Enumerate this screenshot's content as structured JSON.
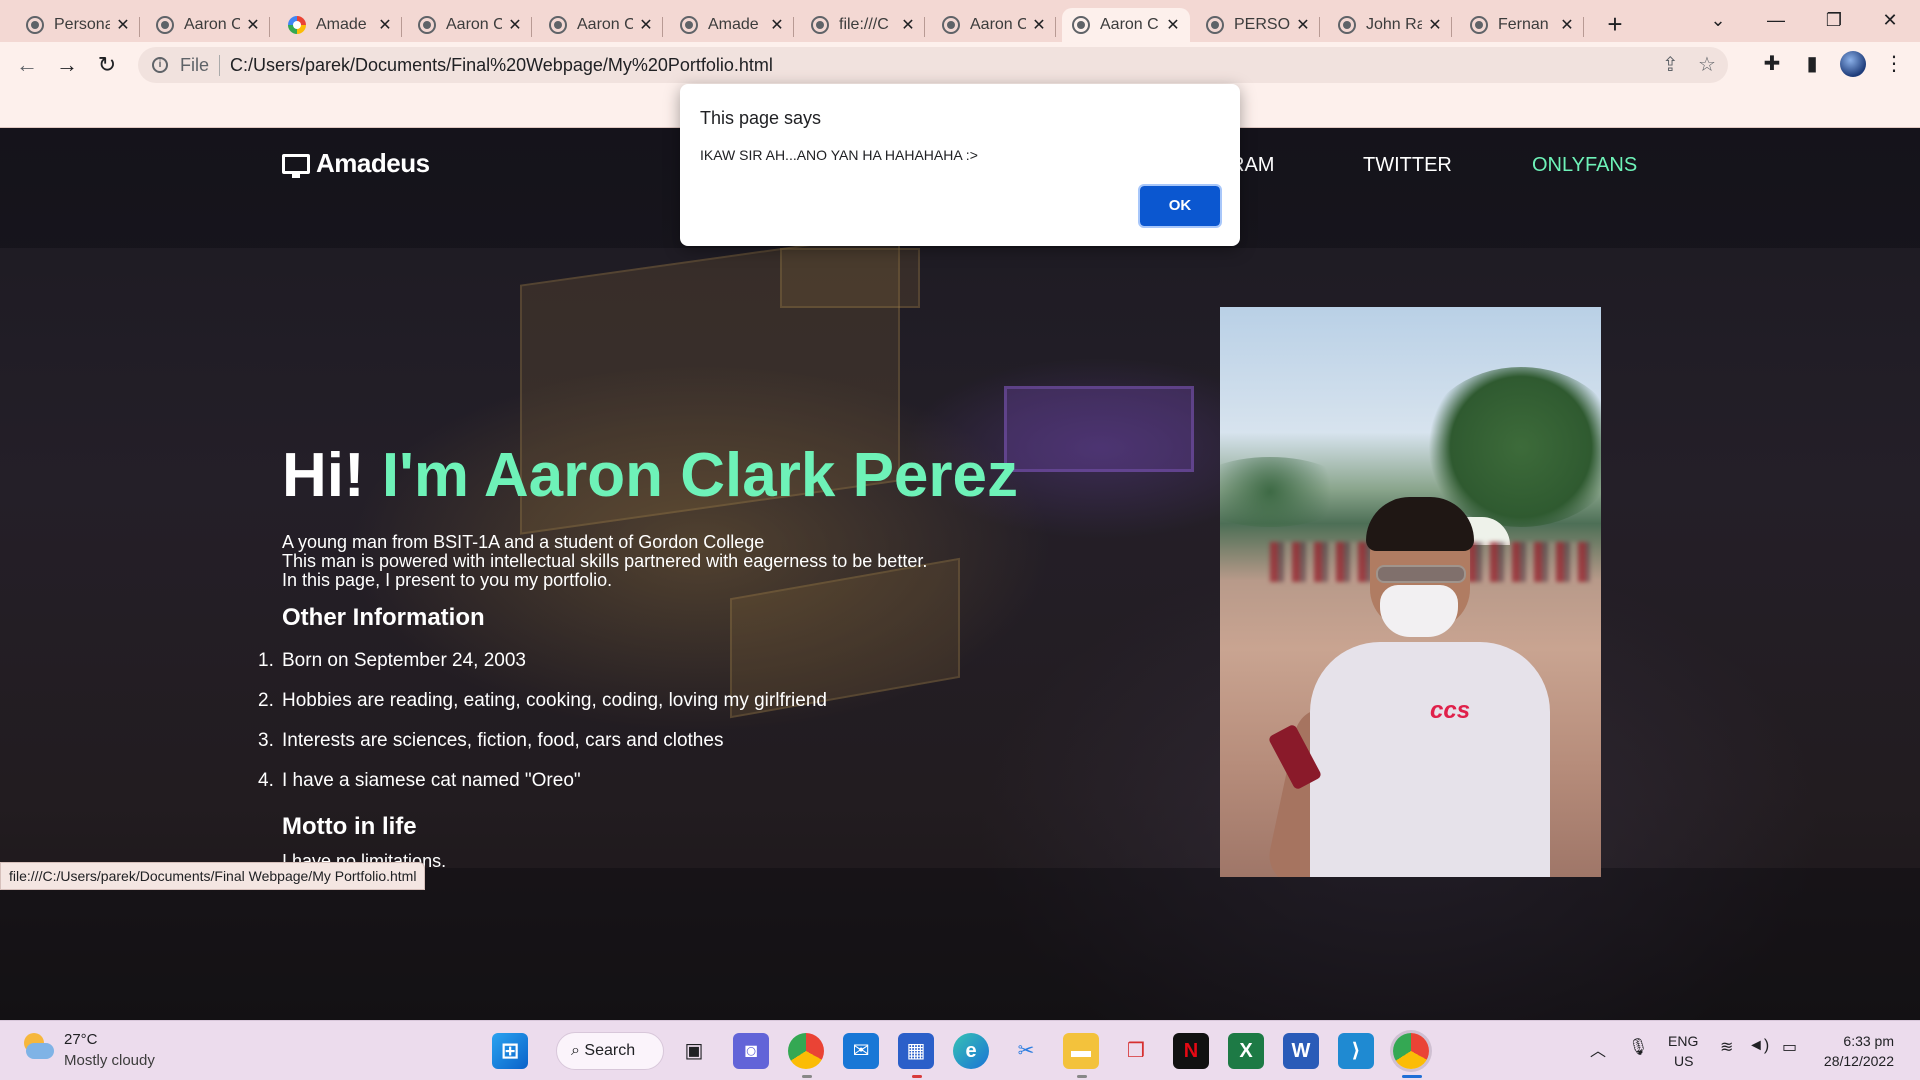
{
  "browser": {
    "tabs": [
      {
        "title": "Persona",
        "favicon": "globe-icon"
      },
      {
        "title": "Aaron C",
        "favicon": "globe-icon"
      },
      {
        "title": "Amade",
        "favicon": "google-icon"
      },
      {
        "title": "Aaron C",
        "favicon": "globe-icon"
      },
      {
        "title": "Aaron C",
        "favicon": "globe-icon"
      },
      {
        "title": "Amade",
        "favicon": "globe-icon"
      },
      {
        "title": "file:///C",
        "favicon": "globe-icon"
      },
      {
        "title": "Aaron C",
        "favicon": "globe-icon"
      },
      {
        "title": "Aaron C",
        "favicon": "globe-icon",
        "active": true
      },
      {
        "title": "PERSON",
        "favicon": "globe-icon"
      },
      {
        "title": "John Ra",
        "favicon": "globe-icon"
      },
      {
        "title": "Fernan",
        "favicon": "globe-icon"
      }
    ],
    "new_tab": "+",
    "address": {
      "scheme_label": "File",
      "url": "C:/Users/parek/Documents/Final%20Webpage/My%20Portfolio.html"
    },
    "status_url": "file:///C:/Users/parek/Documents/Final Webpage/My Portfolio.html"
  },
  "dialog": {
    "title": "This page says",
    "message": "IKAW SIR AH...ANO YAN HA HAHAHAHA :>",
    "ok_label": "OK"
  },
  "site": {
    "logo_text": "Amadeus",
    "nav": [
      {
        "label": "RAM"
      },
      {
        "label": "TWITTER"
      },
      {
        "label": "ONLYFANS",
        "accent": true
      }
    ],
    "hero": {
      "greeting": "Hi!",
      "name": "I'm Aaron Clark Perez"
    },
    "intro_lines": [
      "A young man from BSIT-1A and a student of Gordon College",
      "This man is powered with intellectual skills partnered with eagerness to be better.",
      "In this page, I present to you my portfolio."
    ],
    "other_info_heading": "Other Information",
    "facts": [
      {
        "num": "1.",
        "text": "Born on September 24, 2003"
      },
      {
        "num": "2.",
        "text": "Hobbies are reading, eating, cooking, coding, loving my girlfriend"
      },
      {
        "num": "3.",
        "text": "Interests are sciences, fiction, food, cars and clothes"
      },
      {
        "num": "4.",
        "text": "I have a siamese cat named \"Oreo\""
      }
    ],
    "motto_heading": "Motto in life",
    "motto": "I have no limitations.",
    "photo_shirt_text": "ccs",
    "accent_color": "#6ef2b8"
  },
  "taskbar": {
    "weather_temp": "27°C",
    "weather_desc": "Mostly cloudy",
    "search_label": "Search",
    "lang_line1": "ENG",
    "lang_line2": "US",
    "time": "6:33 pm",
    "date": "28/12/2022",
    "apps": [
      "windows-start-icon",
      "task-view-icon",
      "teams-chat-icon",
      "chrome-icon",
      "mail-icon",
      "store-icon",
      "edge-icon",
      "snipping-tool-icon",
      "file-explorer-icon",
      "gift-icon",
      "netflix-icon",
      "excel-icon",
      "word-icon",
      "vscode-icon",
      "chrome-profile-icon"
    ]
  }
}
